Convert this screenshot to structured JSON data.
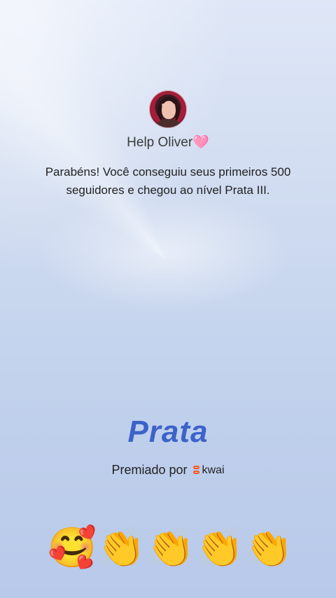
{
  "profile": {
    "username": "Help Oliver🩷",
    "message": "Parabéns! Você conseguiu seus primeiros 500 seguidores e chegou ao nível Prata III."
  },
  "level": {
    "title": "Prata"
  },
  "award": {
    "prefix": "Premiado por",
    "brand": "kwai"
  },
  "reactions": [
    "🥰",
    "👏",
    "👏",
    "👏",
    "👏"
  ],
  "colors": {
    "accent": "#3d63c9",
    "brand": "#ff5a1f"
  }
}
